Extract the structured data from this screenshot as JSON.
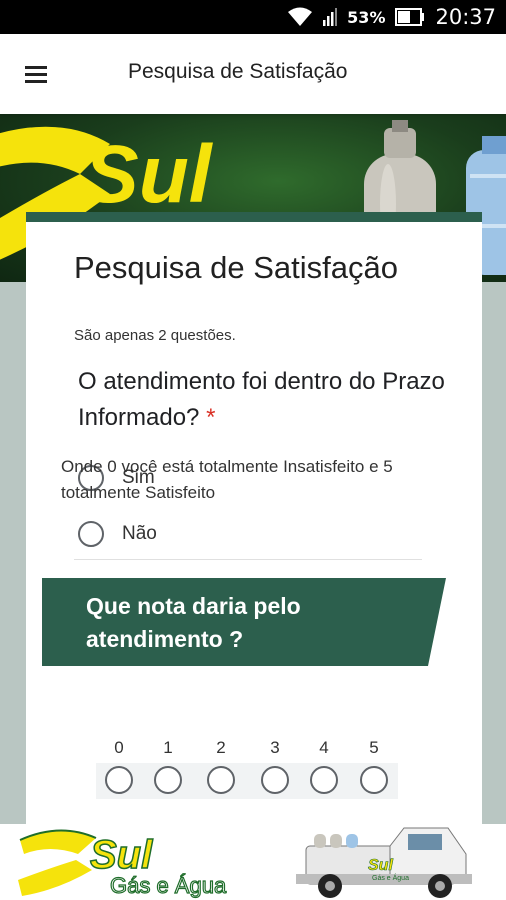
{
  "status_bar": {
    "battery_percent": "53%",
    "time": "20:37"
  },
  "app_bar": {
    "title": "Pesquisa de Satisfação"
  },
  "banner": {
    "brand": "Sul"
  },
  "form": {
    "title": "Pesquisa de Satisfação",
    "description": "São apenas 2 questões.",
    "question1": {
      "title": "O atendimento foi dentro do Prazo Informado?",
      "required_mark": "*",
      "options": [
        "Sim",
        "Não"
      ]
    },
    "section": {
      "title": "Que nota daria pelo atendimento ?",
      "description": "Onde 0 você está totalmente Insatisfeito e 5 totalmente Satisfeito",
      "scale": [
        "0",
        "1",
        "2",
        "3",
        "4",
        "5"
      ]
    }
  },
  "footer_banner": {
    "brand": "Sul",
    "tagline": "Gás e Água",
    "truck_label": "Sul",
    "truck_sub": "Gás e Água"
  },
  "colors": {
    "accent": "#2c5f4d",
    "brand_yellow": "#f5e30c",
    "required": "#d93025"
  }
}
